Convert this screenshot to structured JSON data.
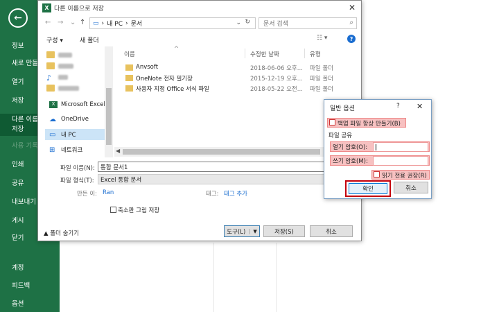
{
  "backstage": {
    "items": [
      {
        "label": "정보"
      },
      {
        "label": "새로 만들기"
      },
      {
        "label": "열기"
      },
      {
        "label": "저장"
      },
      {
        "label": "다른 이름으로 저장"
      },
      {
        "label": "사용 기록"
      },
      {
        "label": "인쇄"
      },
      {
        "label": "공유"
      },
      {
        "label": "내보내기"
      },
      {
        "label": "게시"
      },
      {
        "label": "닫기"
      },
      {
        "label": "계정"
      },
      {
        "label": "피드백"
      },
      {
        "label": "옵션"
      }
    ],
    "active_line1": "다른 이름",
    "active_line2": "저장"
  },
  "saveas": {
    "title": "다른 이름으로 저장",
    "address": {
      "pc": "내 PC",
      "folder": "문서"
    },
    "search_placeholder": "문서 검색",
    "toolbar": {
      "organize": "구성 ▾",
      "new_folder": "새 폴더"
    },
    "nav": {
      "onedrive": "OneDrive",
      "microsoft_excel": "Microsoft Excel",
      "this_pc": "내 PC",
      "network": "네트워크"
    },
    "columns": {
      "name": "이름",
      "date": "수정한 날짜",
      "type": "유형"
    },
    "files": [
      {
        "name": "Anvsoft",
        "date": "2018-06-06 오후...",
        "type": "파일 폴더"
      },
      {
        "name": "OneNote 전자 필기장",
        "date": "2015-12-19 오후...",
        "type": "파일 폴더"
      },
      {
        "name": "사용자 지정 Office 서식 파일",
        "date": "2018-05-22 오전...",
        "type": "파일 폴더"
      }
    ],
    "form": {
      "filename_label": "파일 이름(N):",
      "filename_value": "통합 문서1",
      "filetype_label": "파일 형식(T):",
      "filetype_value": "Excel 통합 문서",
      "author_label": "만든 이:",
      "author_value": "Ran",
      "tags_label": "태그:",
      "tags_value": "태그 추가",
      "thumbnail_label": "축소판 그림 저장"
    },
    "hide_folders": "▲ 폴더 숨기기",
    "buttons": {
      "tools": "도구(L)",
      "save": "저장(S)",
      "cancel": "취소"
    }
  },
  "general_options": {
    "title": "일반 옵션",
    "help": "?",
    "backup_label": "백업 파일 항상 만들기(B)",
    "file_sharing": "파일 공유",
    "open_pw_label": "열기 암호(O):",
    "modify_pw_label": "쓰기 암호(M):",
    "readonly_label": "읽기 전용 권장(R)",
    "ok": "확인",
    "cancel": "취소"
  },
  "colors": {
    "excel_green": "#1e7145",
    "highlight": "#f7c1c1",
    "ok_border": "#c4000c"
  }
}
